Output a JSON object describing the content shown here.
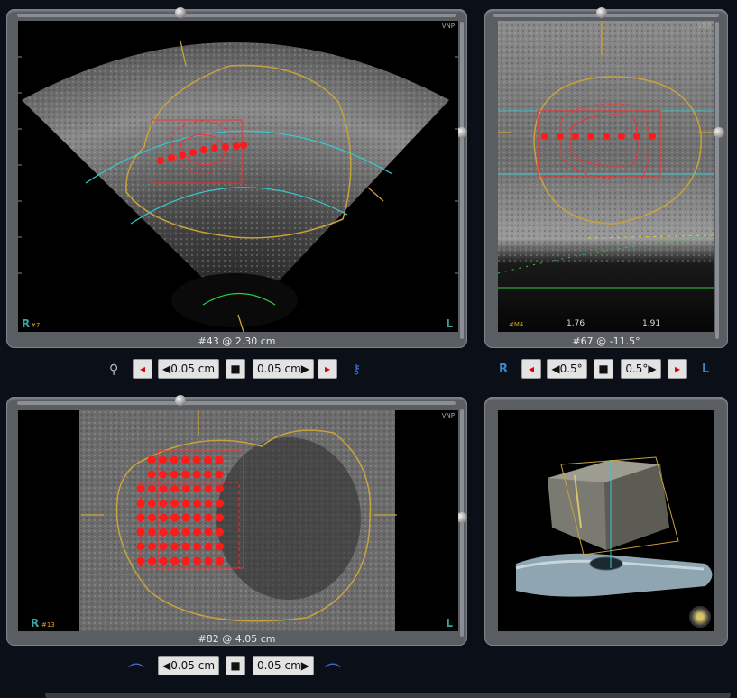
{
  "views": {
    "top_left": {
      "caption": "#43 @ 2.30 cm",
      "corner_left": "R",
      "corner_left_small": "#7",
      "corner_right": "L",
      "top_right_tag": "VNP"
    },
    "top_right": {
      "caption": "#67 @ -11.5°",
      "readout_series": "#M4",
      "readout_a": "1.76",
      "readout_b": "1.91",
      "top_right_tag": "VNP"
    },
    "bottom_left": {
      "caption": "#82 @ 4.05 cm",
      "corner_left": "R",
      "corner_left_small": "#13",
      "corner_right": "L",
      "top_right_tag": "VNP"
    }
  },
  "controls": {
    "row1": {
      "step_left": "0.05 cm",
      "step_right": "0.05 cm"
    },
    "row2": {
      "side_left": "R",
      "step_left": "0.5°",
      "step_right": "0.5°",
      "side_right": "L"
    },
    "row3": {
      "step_left": "0.05 cm",
      "step_right": "0.05 cm"
    }
  },
  "icons": {
    "prev": "red-arrow-left-icon",
    "next": "red-arrow-right-icon",
    "decrement": "triangle-left-icon",
    "increment": "triangle-right-icon",
    "center": "center-block-icon",
    "probe": "probe-icon",
    "eye": "eye-icon"
  },
  "colors": {
    "prostate_contour": "#c8a23a",
    "target_grid": "#ff1a1a",
    "needle_plane": "#35c9d2",
    "background": "#0b0f18"
  }
}
